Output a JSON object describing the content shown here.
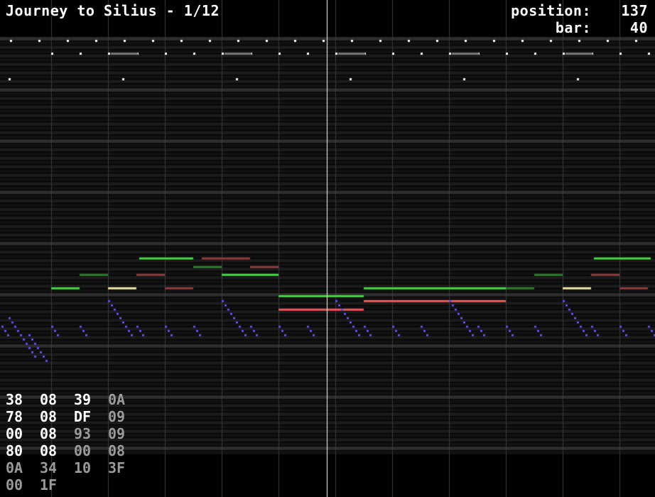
{
  "header": {
    "title": "Journey to Silius - 1/12",
    "position_label": "position:",
    "position_value": "137",
    "bar_label": "bar:",
    "bar_value": "40"
  },
  "colors": {
    "background": "#000000",
    "lane_dark": "#1a1a1a",
    "lane_light": "#2c2c2c",
    "beat_line": "#3a3a3a",
    "playhead": "#ffffff",
    "pulse1": "#3fd23f",
    "pulse1_faded": "#2a7a2a",
    "pulse2": "#e05a5a",
    "pulse2_faded": "#8a3a3a",
    "triangle_accent": "#e8e0a0",
    "noise": "#5a4df0",
    "drums": "#ffffff",
    "register_bright": "#ffffff",
    "register_dim": "#9a9a9a"
  },
  "registers": [
    [
      {
        "v": "38",
        "dim": false
      },
      {
        "v": "08",
        "dim": false
      },
      {
        "v": "39",
        "dim": false
      },
      {
        "v": "0A",
        "dim": true
      }
    ],
    [
      {
        "v": "78",
        "dim": false
      },
      {
        "v": "08",
        "dim": false
      },
      {
        "v": "DF",
        "dim": false
      },
      {
        "v": "09",
        "dim": true
      }
    ],
    [
      {
        "v": "00",
        "dim": false
      },
      {
        "v": "08",
        "dim": false
      },
      {
        "v": "93",
        "dim": true
      },
      {
        "v": "09",
        "dim": true
      }
    ],
    [
      {
        "v": "80",
        "dim": false
      },
      {
        "v": "08",
        "dim": false
      },
      {
        "v": "00",
        "dim": true
      },
      {
        "v": "08",
        "dim": true
      }
    ],
    [
      {
        "v": "0A",
        "dim": true
      },
      {
        "v": "34",
        "dim": true
      },
      {
        "v": "10",
        "dim": true
      },
      {
        "v": "3F",
        "dim": true
      }
    ],
    [
      {
        "v": "00",
        "dim": true
      },
      {
        "v": "1F",
        "dim": true
      }
    ]
  ]
}
